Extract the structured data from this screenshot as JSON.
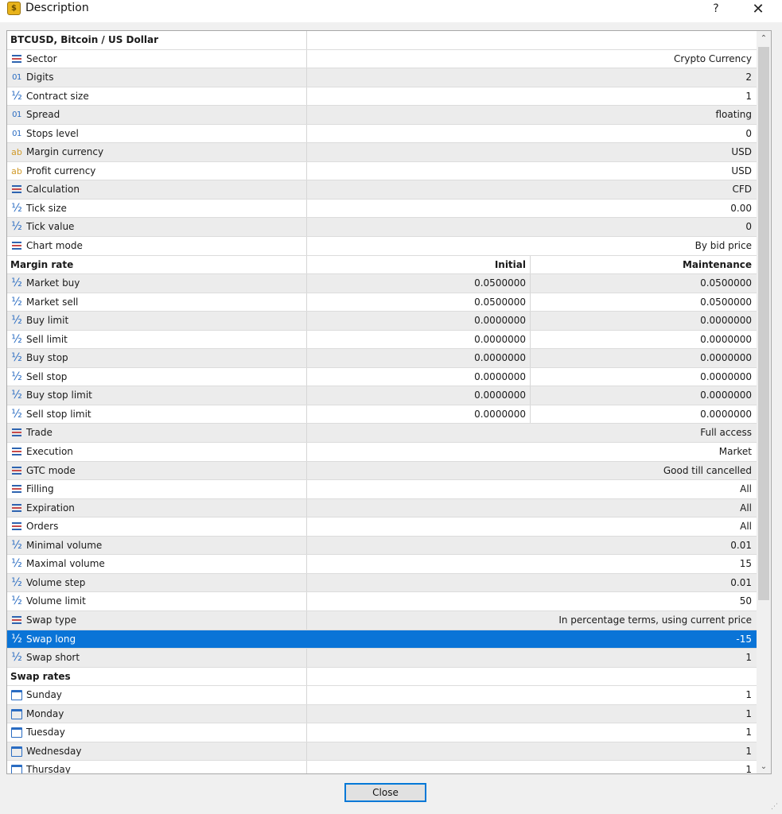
{
  "window": {
    "title": "Description",
    "help_label": "?",
    "close_label": "✕",
    "app_icon_glyph": "$"
  },
  "grid": {
    "rows": [
      {
        "type": "header",
        "name": "BTCUSD, Bitcoin / US Dollar"
      },
      {
        "type": "row",
        "icon": "list-icon",
        "name": "Sector",
        "value": "Crypto Currency"
      },
      {
        "type": "row",
        "icon": "digits-icon",
        "name": "Digits",
        "value": "2"
      },
      {
        "type": "row",
        "icon": "half-icon",
        "name": "Contract size",
        "value": "1"
      },
      {
        "type": "row",
        "icon": "digits-icon",
        "name": "Spread",
        "value": "floating"
      },
      {
        "type": "row",
        "icon": "digits-icon",
        "name": "Stops level",
        "value": "0"
      },
      {
        "type": "row",
        "icon": "ab-icon",
        "name": "Margin currency",
        "value": "USD"
      },
      {
        "type": "row",
        "icon": "ab-icon",
        "name": "Profit currency",
        "value": "USD"
      },
      {
        "type": "row",
        "icon": "list-icon",
        "name": "Calculation",
        "value": "CFD"
      },
      {
        "type": "row",
        "icon": "half-icon",
        "name": "Tick size",
        "value": "0.00"
      },
      {
        "type": "row",
        "icon": "half-icon",
        "name": "Tick value",
        "value": "0"
      },
      {
        "type": "row",
        "icon": "list-icon",
        "name": "Chart mode",
        "value": "By bid price"
      },
      {
        "type": "margin-header",
        "name": "Margin rate",
        "initial": "Initial",
        "maintenance": "Maintenance"
      },
      {
        "type": "margin",
        "icon": "half-icon",
        "name": "Market buy",
        "initial": "0.0500000",
        "maintenance": "0.0500000"
      },
      {
        "type": "margin",
        "icon": "half-icon",
        "name": "Market sell",
        "initial": "0.0500000",
        "maintenance": "0.0500000"
      },
      {
        "type": "margin",
        "icon": "half-icon",
        "name": "Buy limit",
        "initial": "0.0000000",
        "maintenance": "0.0000000"
      },
      {
        "type": "margin",
        "icon": "half-icon",
        "name": "Sell limit",
        "initial": "0.0000000",
        "maintenance": "0.0000000"
      },
      {
        "type": "margin",
        "icon": "half-icon",
        "name": "Buy stop",
        "initial": "0.0000000",
        "maintenance": "0.0000000"
      },
      {
        "type": "margin",
        "icon": "half-icon",
        "name": "Sell stop",
        "initial": "0.0000000",
        "maintenance": "0.0000000"
      },
      {
        "type": "margin",
        "icon": "half-icon",
        "name": "Buy stop limit",
        "initial": "0.0000000",
        "maintenance": "0.0000000"
      },
      {
        "type": "margin",
        "icon": "half-icon",
        "name": "Sell stop limit",
        "initial": "0.0000000",
        "maintenance": "0.0000000"
      },
      {
        "type": "row",
        "icon": "list-icon",
        "name": "Trade",
        "value": "Full access"
      },
      {
        "type": "row",
        "icon": "list-icon",
        "name": "Execution",
        "value": "Market"
      },
      {
        "type": "row",
        "icon": "list-icon",
        "name": "GTC mode",
        "value": "Good till cancelled"
      },
      {
        "type": "row",
        "icon": "list-icon",
        "name": "Filling",
        "value": "All"
      },
      {
        "type": "row",
        "icon": "list-icon",
        "name": "Expiration",
        "value": "All"
      },
      {
        "type": "row",
        "icon": "list-icon",
        "name": "Orders",
        "value": "All"
      },
      {
        "type": "row",
        "icon": "half-icon",
        "name": "Minimal volume",
        "value": "0.01"
      },
      {
        "type": "row",
        "icon": "half-icon",
        "name": "Maximal volume",
        "value": "15"
      },
      {
        "type": "row",
        "icon": "half-icon",
        "name": "Volume step",
        "value": "0.01"
      },
      {
        "type": "row",
        "icon": "half-icon",
        "name": "Volume limit",
        "value": "50"
      },
      {
        "type": "row",
        "icon": "list-icon",
        "name": "Swap type",
        "value": "In percentage terms, using current price"
      },
      {
        "type": "row",
        "icon": "half-icon",
        "name": "Swap long",
        "value": "-15",
        "selected": true
      },
      {
        "type": "row",
        "icon": "half-icon",
        "name": "Swap short",
        "value": "1"
      },
      {
        "type": "header",
        "name": "Swap rates"
      },
      {
        "type": "row",
        "icon": "calendar-icon",
        "name": "Sunday",
        "value": "1"
      },
      {
        "type": "row",
        "icon": "calendar-icon",
        "name": "Monday",
        "value": "1"
      },
      {
        "type": "row",
        "icon": "calendar-icon",
        "name": "Tuesday",
        "value": "1"
      },
      {
        "type": "row",
        "icon": "calendar-icon",
        "name": "Wednesday",
        "value": "1"
      },
      {
        "type": "row",
        "icon": "calendar-icon",
        "name": "Thursday",
        "value": "1"
      }
    ]
  },
  "scrollbar": {
    "up_glyph": "⌃",
    "down_glyph": "⌄"
  },
  "footer": {
    "close_button_label": "Close",
    "grip_glyph": "⋰"
  },
  "colors": {
    "selection": "#0a74d7",
    "accent": "#0078d7",
    "alt_row": "#ececec"
  }
}
